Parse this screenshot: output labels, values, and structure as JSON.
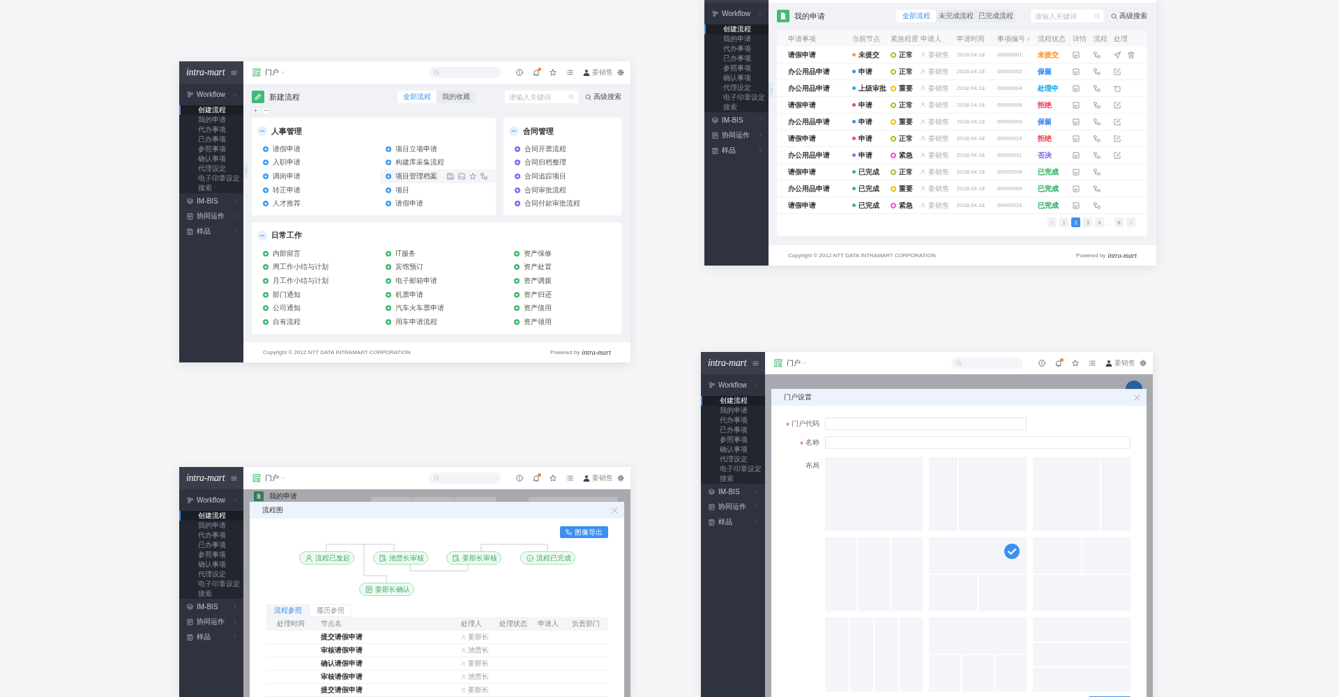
{
  "screens": [
    {
      "kind": "portal",
      "sidebar": {
        "logo": "intra-mart",
        "menu": [
          {
            "label": "Workflow",
            "expanded": true,
            "children": [
              {
                "label": "创建流程",
                "selected": true
              },
              {
                "label": "我的申请",
                "selected": false
              },
              {
                "label": "代办事项",
                "selected": false
              },
              {
                "label": "已办事项",
                "selected": false
              },
              {
                "label": "参照事项",
                "selected": false
              },
              {
                "label": "确认事项",
                "selected": false
              },
              {
                "label": "代理设定",
                "selected": false
              },
              {
                "label": "电子印章设定",
                "selected": false
              },
              {
                "label": "搜索",
                "selected": false
              }
            ]
          },
          {
            "label": "IM-BIS",
            "expanded": false
          },
          {
            "label": "协同运作",
            "expanded": false
          },
          {
            "label": "样品",
            "expanded": false
          }
        ]
      },
      "topbar": {
        "portal": "门户",
        "user": "姜销售",
        "notification_dot": true
      },
      "page": {
        "title": "新建流程",
        "tabs": [
          {
            "label": "全部流程",
            "selected": true
          },
          {
            "label": "我的收藏",
            "selected": false
          }
        ],
        "search": {
          "placeholder": "请输入关键词"
        },
        "advanced_search": "高级搜索",
        "groups": [
          {
            "title": "人事管理",
            "expanded": true,
            "color": "#3c9df2",
            "columns": [
              [
                {
                  "label": "请假申请",
                  "hovered": false
                },
                {
                  "label": "入职申请",
                  "hovered": false
                },
                {
                  "label": "调岗申请",
                  "hovered": false
                },
                {
                  "label": "转正申请",
                  "hovered": false
                },
                {
                  "label": "人才推荐",
                  "hovered": false
                }
              ],
              [
                {
                  "label": "项目立项申请",
                  "hovered": false
                },
                {
                  "label": "构建库采集流程",
                  "hovered": false
                },
                {
                  "label": "项目管理档案",
                  "hovered": true
                },
                {
                  "label": "项目",
                  "hovered": false
                },
                {
                  "label": "请假申请",
                  "hovered": false
                }
              ]
            ]
          },
          {
            "title": "合同管理",
            "expanded": true,
            "color": "#7f6df0",
            "columns": [
              [
                {
                  "label": "合同开票流程",
                  "hovered": false
                },
                {
                  "label": "合同归档整理",
                  "hovered": false
                },
                {
                  "label": "合同追踪项目",
                  "hovered": false
                },
                {
                  "label": "合同审批流程",
                  "hovered": false
                },
                {
                  "label": "合同付款审批流程",
                  "hovered": false
                }
              ]
            ]
          },
          {
            "title": "日常工作",
            "expanded": true,
            "color": "#3dba6f",
            "columns": [
              [
                {
                  "label": "内部留言",
                  "hovered": false
                },
                {
                  "label": "周工作小结与计划",
                  "hovered": false
                },
                {
                  "label": "月工作小结与计划",
                  "hovered": false
                },
                {
                  "label": "部门通知",
                  "hovered": false
                },
                {
                  "label": "公司通知",
                  "hovered": false
                },
                {
                  "label": "自有流程",
                  "hovered": false
                }
              ],
              [
                {
                  "label": "IT服务",
                  "hovered": false
                },
                {
                  "label": "宾馆预订",
                  "hovered": false
                },
                {
                  "label": "电子邮箱申请",
                  "hovered": false
                },
                {
                  "label": "机票申请",
                  "hovered": false
                },
                {
                  "label": "汽车火车票申请",
                  "hovered": false
                },
                {
                  "label": "用车申请流程",
                  "hovered": false
                }
              ],
              [
                {
                  "label": "资产保修",
                  "hovered": false
                },
                {
                  "label": "资产处置",
                  "hovered": false
                },
                {
                  "label": "资产调拨",
                  "hovered": false
                },
                {
                  "label": "资产归还",
                  "hovered": false
                },
                {
                  "label": "资产借用",
                  "hovered": false
                },
                {
                  "label": "资产领用",
                  "hovered": false
                }
              ]
            ]
          }
        ]
      },
      "footer": {
        "copyright": "Copyright © 2012 NTT DATA INTRAMART CORPORATION",
        "powered_by": "Powered by",
        "logo": "intra-mart"
      }
    },
    {
      "kind": "requests",
      "sidebar": {
        "menu": [
          {
            "label": "Workflow",
            "expanded": true,
            "children": [
              {
                "label": "创建流程",
                "selected": true
              },
              {
                "label": "我的申请",
                "selected": false
              },
              {
                "label": "代办事项",
                "selected": false
              },
              {
                "label": "已办事项",
                "selected": false
              },
              {
                "label": "参照事项",
                "selected": false
              },
              {
                "label": "确认事项",
                "selected": false
              },
              {
                "label": "代理设定",
                "selected": false
              },
              {
                "label": "电子印章设定",
                "selected": false
              },
              {
                "label": "搜索",
                "selected": false
              }
            ]
          },
          {
            "label": "IM-BIS",
            "expanded": false
          },
          {
            "label": "协同运作",
            "expanded": false
          },
          {
            "label": "样品",
            "expanded": false
          }
        ]
      },
      "page": {
        "title": "我的申请",
        "tabs": [
          {
            "label": "全部流程",
            "selected": true
          },
          {
            "label": "未完成流程",
            "selected": false
          },
          {
            "label": "已完成流程",
            "selected": false
          }
        ],
        "search": {
          "placeholder": "请输入关键词"
        },
        "advanced_search": "高级搜索",
        "table": {
          "columns": [
            {
              "label": "申请事项",
              "sortable": false
            },
            {
              "label": "当前节点",
              "sortable": false
            },
            {
              "label": "紧急程度",
              "sortable": false
            },
            {
              "label": "申请人",
              "sortable": false
            },
            {
              "label": "申请时间",
              "sortable": false
            },
            {
              "label": "事项编号",
              "sortable": true
            },
            {
              "label": "流程状态",
              "sortable": false
            },
            {
              "label": "详情",
              "sortable": false
            },
            {
              "label": "流程",
              "sortable": false
            },
            {
              "label": "处理",
              "sortable": false
            }
          ],
          "rows": [
            {
              "item": "请假申请",
              "node": {
                "text": "未提交",
                "color": "#f5a03c"
              },
              "urgency": {
                "text": "正常",
                "color": "#9acd32"
              },
              "applicant": "姜销售",
              "time": "2018.04.18",
              "number": "00000001",
              "status": {
                "text": "未提交",
                "color": "#f5a03c"
              },
              "actions": [
                {
                  "kind": "send"
                },
                {
                  "kind": "delete"
                }
              ]
            },
            {
              "item": "办公用品申请",
              "node": {
                "text": "申请",
                "color": "#3d8ff0"
              },
              "urgency": {
                "text": "正常",
                "color": "#9acd32"
              },
              "applicant": "姜销售",
              "time": "2018.04.18",
              "number": "00000002",
              "status": {
                "text": "保留",
                "color": "#3d8ff0"
              },
              "actions": [
                {
                  "kind": "edit"
                }
              ]
            },
            {
              "item": "办公用品申请",
              "node": {
                "text": "上级审批",
                "color": "#1ab0e8"
              },
              "urgency": {
                "text": "重要",
                "color": "#f2c21b"
              },
              "applicant": "姜销售",
              "time": "2018.04.18",
              "number": "00000004",
              "status": {
                "text": "处理中",
                "color": "#1ab0e8"
              },
              "actions": [
                {
                  "kind": "recall"
                }
              ]
            },
            {
              "item": "请假申请",
              "node": {
                "text": "申请",
                "color": "#f0505a"
              },
              "urgency": {
                "text": "正常",
                "color": "#9acd32"
              },
              "applicant": "姜销售",
              "time": "2018.04.18",
              "number": "00000008",
              "status": {
                "text": "拒绝",
                "color": "#f0505a"
              },
              "actions": [
                {
                  "kind": "edit"
                }
              ]
            },
            {
              "item": "办公用品申请",
              "node": {
                "text": "申请",
                "color": "#3d8ff0"
              },
              "urgency": {
                "text": "重要",
                "color": "#f2c21b"
              },
              "applicant": "姜销售",
              "time": "2018.04.18",
              "number": "00000009",
              "status": {
                "text": "保留",
                "color": "#3d8ff0"
              },
              "actions": [
                {
                  "kind": "edit"
                }
              ]
            },
            {
              "item": "请假申请",
              "node": {
                "text": "申请",
                "color": "#f0505a"
              },
              "urgency": {
                "text": "正常",
                "color": "#9acd32"
              },
              "applicant": "姜销售",
              "time": "2018.04.18",
              "number": "00000010",
              "status": {
                "text": "拒绝",
                "color": "#f0505a"
              },
              "actions": [
                {
                  "kind": "edit"
                }
              ]
            },
            {
              "item": "办公用品申请",
              "node": {
                "text": "申请",
                "color": "#8e72f0"
              },
              "urgency": {
                "text": "紧急",
                "color": "#ea5fd7"
              },
              "applicant": "姜销售",
              "time": "2018.04.18",
              "number": "00000011",
              "status": {
                "text": "否决",
                "color": "#8e72f0"
              },
              "actions": [
                {
                  "kind": "edit"
                }
              ]
            },
            {
              "item": "请假申请",
              "node": {
                "text": "已完成",
                "color": "#3dba6f"
              },
              "urgency": {
                "text": "正常",
                "color": "#9acd32"
              },
              "applicant": "姜销售",
              "time": "2018.04.18",
              "number": "00000008",
              "status": {
                "text": "已完成",
                "color": "#3dba6f"
              }
            },
            {
              "item": "办公用品申请",
              "node": {
                "text": "已完成",
                "color": "#3dba6f"
              },
              "urgency": {
                "text": "重要",
                "color": "#f2c21b"
              },
              "applicant": "姜销售",
              "time": "2018.04.18",
              "number": "00000009",
              "status": {
                "text": "已完成",
                "color": "#3dba6f"
              }
            },
            {
              "item": "请假申请",
              "node": {
                "text": "已完成",
                "color": "#3dba6f"
              },
              "urgency": {
                "text": "紧急",
                "color": "#ea5fd7"
              },
              "applicant": "姜销售",
              "time": "2018.04.18",
              "number": "00000010",
              "status": {
                "text": "已完成",
                "color": "#3dba6f"
              }
            }
          ],
          "pagination": [
            {
              "label": "1",
              "kind": "page",
              "selected": false
            },
            {
              "label": "2",
              "kind": "page",
              "selected": true
            },
            {
              "label": "3",
              "kind": "page",
              "selected": false
            },
            {
              "label": "4",
              "kind": "page",
              "selected": false
            },
            {
              "label": "...",
              "kind": "ellipsis",
              "selected": false
            },
            {
              "label": "8",
              "kind": "page",
              "selected": false
            }
          ]
        }
      },
      "footer": {
        "copyright": "Copyright © 2012 NTT DATA INTRAMART CORPORATION",
        "powered_by": "Powered by",
        "logo": "intra-mart"
      }
    },
    {
      "kind": "flowdialog",
      "sidebar": {
        "logo": "intra-mart",
        "menu": [
          {
            "label": "Workflow",
            "expanded": true,
            "children": [
              {
                "label": "创建流程",
                "selected": true
              },
              {
                "label": "我的申请",
                "selected": false
              },
              {
                "label": "代办事项",
                "selected": false
              },
              {
                "label": "已办事项",
                "selected": false
              },
              {
                "label": "参照事项",
                "selected": false
              },
              {
                "label": "确认事项",
                "selected": false
              },
              {
                "label": "代理设定",
                "selected": false
              },
              {
                "label": "电子印章设定",
                "selected": false
              },
              {
                "label": "搜索",
                "selected": false
              }
            ]
          },
          {
            "label": "IM-BIS",
            "expanded": false
          },
          {
            "label": "协同运作",
            "expanded": false
          },
          {
            "label": "样品",
            "expanded": false
          }
        ]
      },
      "topbar": {
        "portal": "门户",
        "user": "姜销售",
        "notification_dot": true
      },
      "background": {
        "title": "我的申请"
      },
      "dialog": {
        "title": "流程图",
        "export_button": "图像导出",
        "nodes": [
          {
            "label": "流程已发起",
            "kind": "start"
          },
          {
            "label": "池营长审核",
            "kind": "review"
          },
          {
            "label": "姜部长审核",
            "kind": "review"
          },
          {
            "label": "流程已完成",
            "kind": "end"
          },
          {
            "label": "姜部长确认",
            "kind": "confirm"
          }
        ],
        "tabs": [
          {
            "label": "流程参照",
            "selected": true
          },
          {
            "label": "履历参照",
            "selected": false
          }
        ],
        "table": {
          "columns": [
            "处理时间",
            "节点名",
            "处理人",
            "处理状态",
            "申请人",
            "负责部门"
          ],
          "rows": [
            {
              "node": "提交请假申请",
              "handler": "姜部长"
            },
            {
              "node": "审核请假申请",
              "handler": "池营长"
            },
            {
              "node": "确认请假申请",
              "handler": "姜部长"
            },
            {
              "node": "审核请假申请",
              "handler": "池营长"
            },
            {
              "node": "提交请假申请",
              "handler": "姜部长"
            }
          ]
        }
      }
    },
    {
      "kind": "portalsettings",
      "sidebar": {
        "logo": "intra-mart",
        "menu": [
          {
            "label": "Workflow",
            "expanded": true,
            "children": [
              {
                "label": "创建流程",
                "selected": true
              },
              {
                "label": "我的申请",
                "selected": false
              },
              {
                "label": "代办事项",
                "selected": false
              },
              {
                "label": "已办事项",
                "selected": false
              },
              {
                "label": "参照事项",
                "selected": false
              },
              {
                "label": "确认事项",
                "selected": false
              },
              {
                "label": "代理设定",
                "selected": false
              },
              {
                "label": "电子印章设定",
                "selected": false
              },
              {
                "label": "搜索",
                "selected": false
              }
            ]
          },
          {
            "label": "IM-BIS",
            "expanded": false
          },
          {
            "label": "协同运作",
            "expanded": false
          },
          {
            "label": "样品",
            "expanded": false
          }
        ]
      },
      "topbar": {
        "portal": "门户",
        "user": "姜销售",
        "notification_dot": true
      },
      "dialog": {
        "title": "门户设置",
        "fields": [
          {
            "label": "门户代码",
            "required": true,
            "kind": "short"
          },
          {
            "label": "名称",
            "required": true,
            "kind": "long"
          }
        ],
        "layout_label": "布局",
        "layouts": [
          {
            "kind": "single",
            "selected": false
          },
          {
            "kind": "narrowleft",
            "selected": false
          },
          {
            "kind": "narrowright",
            "selected": false
          },
          {
            "kind": "thirds",
            "selected": false
          },
          {
            "kind": "bannertop",
            "selected": true
          },
          {
            "kind": "bannerbottom",
            "selected": false
          },
          {
            "kind": "quarters",
            "selected": false
          },
          {
            "kind": "bannerthirds",
            "selected": false
          },
          {
            "kind": "rows",
            "selected": false
          }
        ]
      }
    }
  ]
}
